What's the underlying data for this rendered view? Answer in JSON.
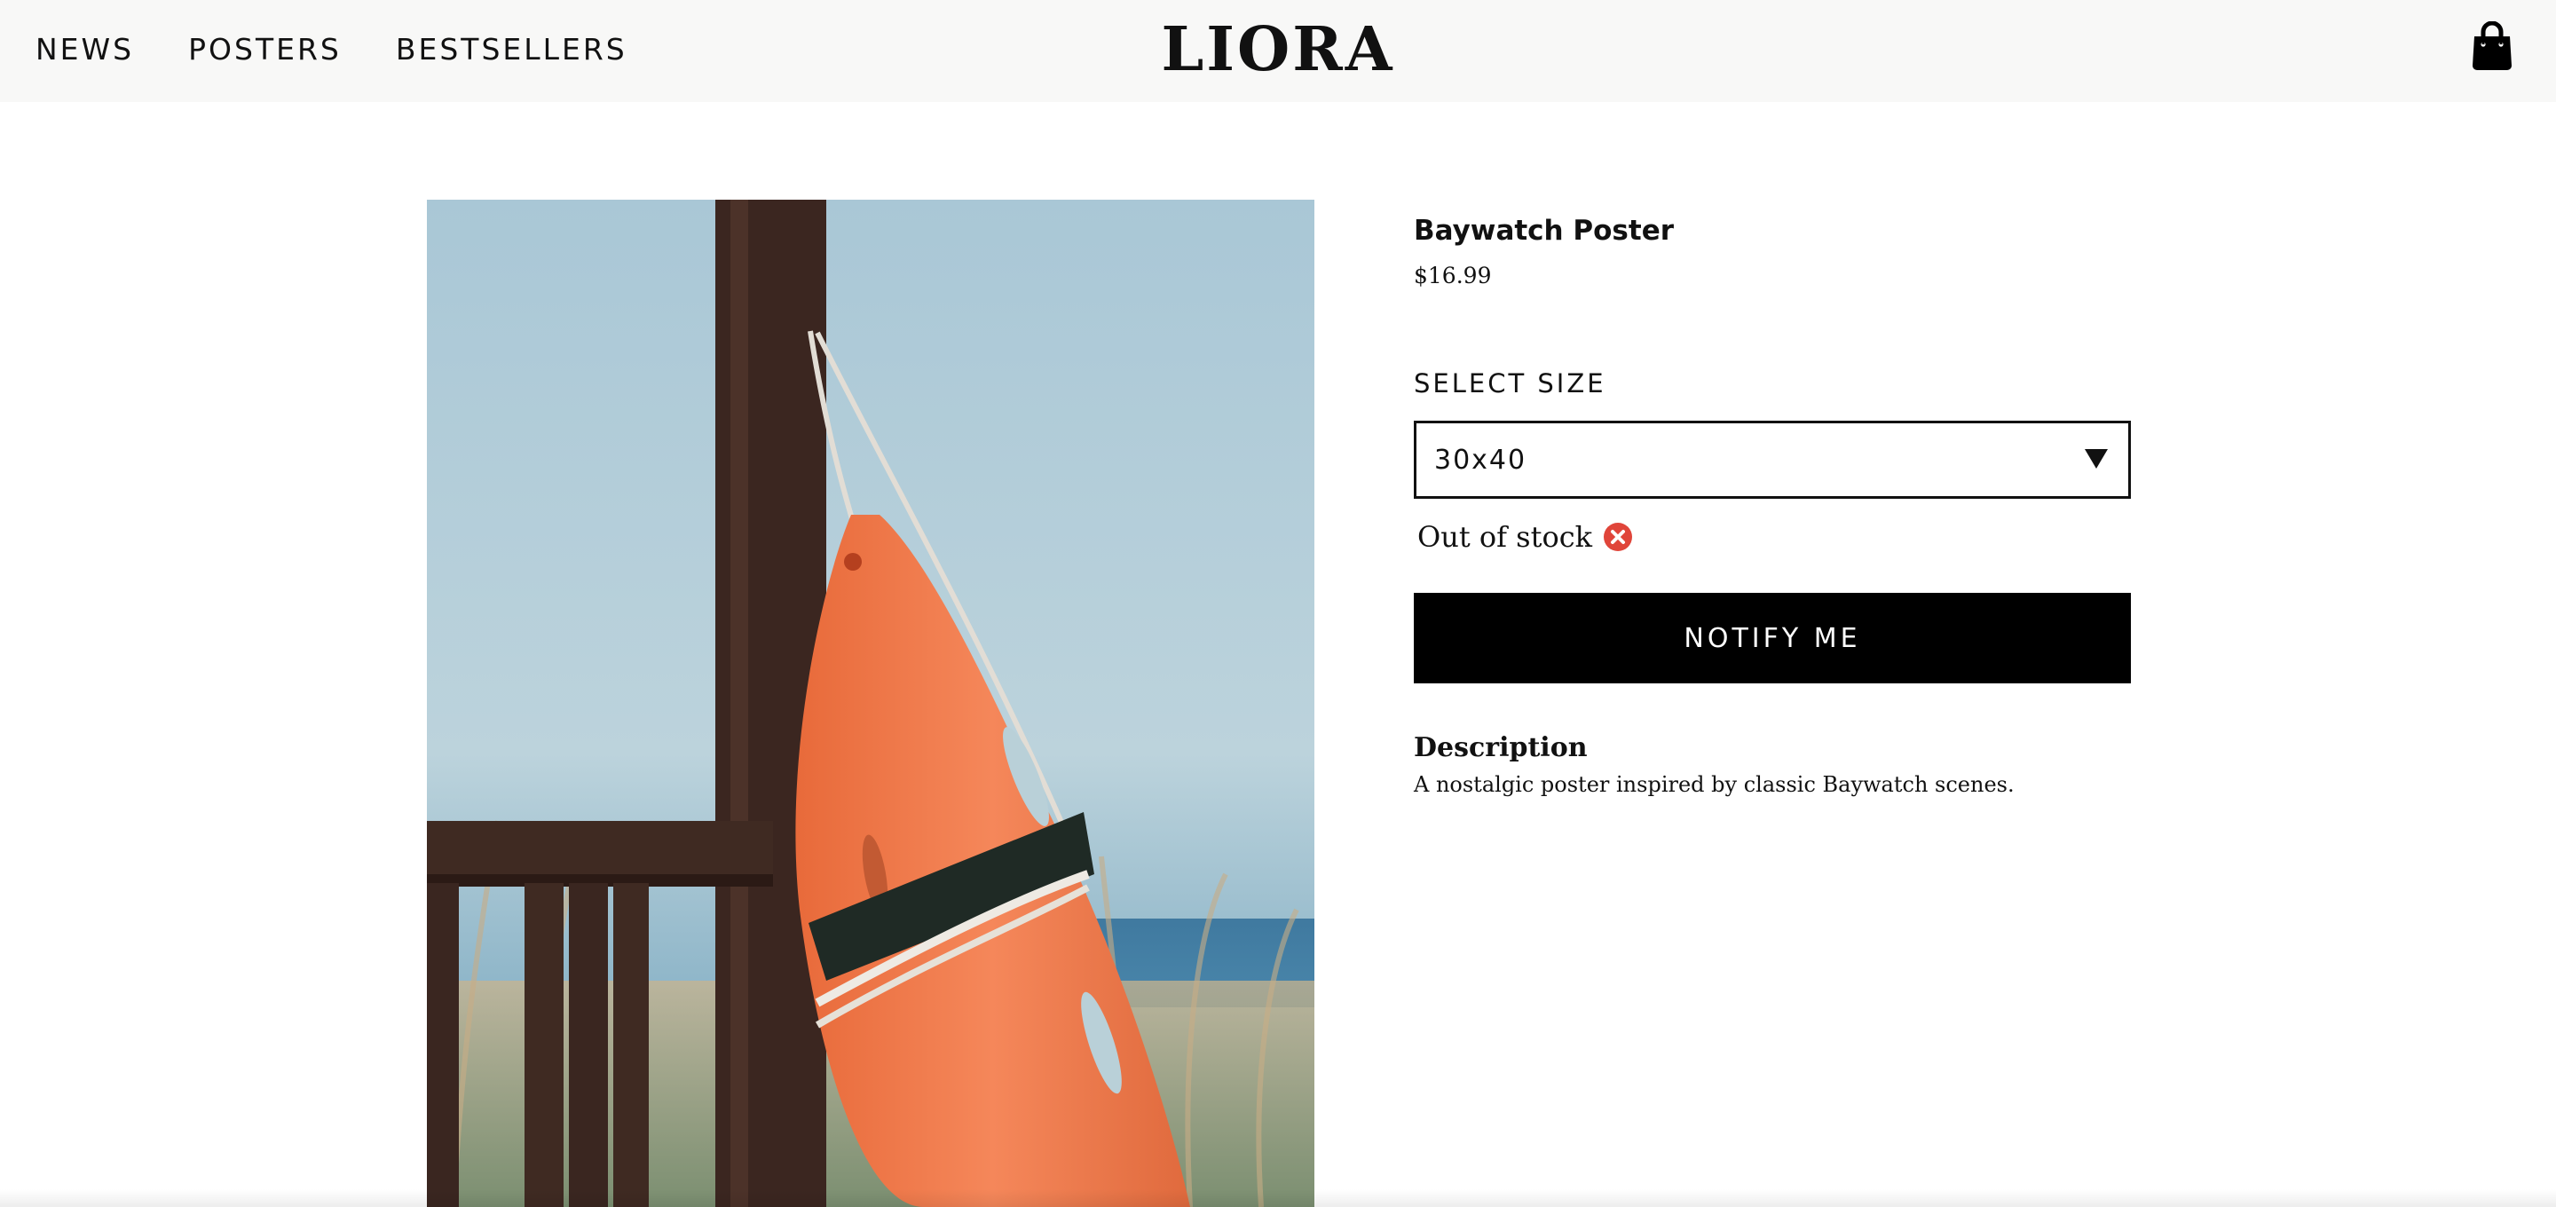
{
  "nav": {
    "items": [
      {
        "label": "NEWS"
      },
      {
        "label": "POSTERS"
      },
      {
        "label": "BESTSELLERS"
      }
    ]
  },
  "brand": {
    "name": "LIORA"
  },
  "cart": {
    "icon": "shopping-bag-icon"
  },
  "product": {
    "image_alt": "Orange lifeguard rescue buoy hanging on a wooden post",
    "title": "Baywatch Poster",
    "price": "$16.99",
    "size_label": "SELECT SIZE",
    "selected_size": "30x40",
    "stock_status": "Out of stock",
    "stock_icon": "close-circle-icon",
    "notify_label": "NOTIFY ME",
    "description_heading": "Description",
    "description_text": "A nostalgic poster inspired by classic Baywatch scenes."
  },
  "colors": {
    "header_bg": "#f8f8f7",
    "button_bg": "#000000",
    "out_of_stock_red": "#e0453a",
    "buoy_orange": "#f07a4a"
  }
}
